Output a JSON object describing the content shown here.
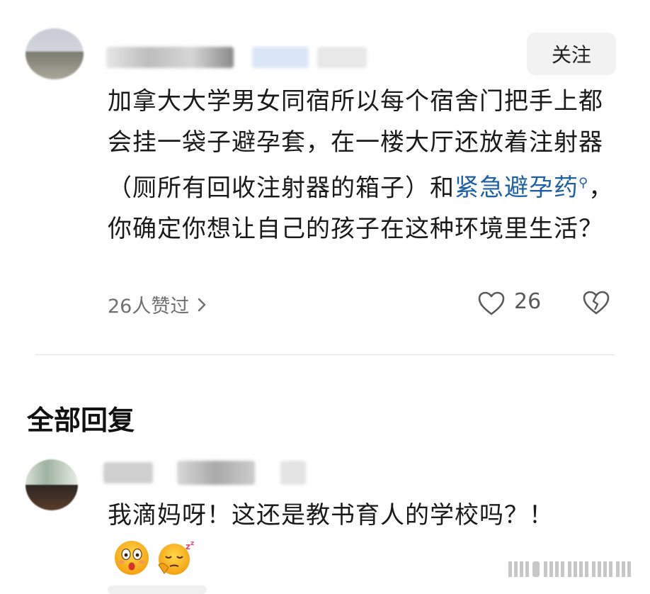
{
  "comment": {
    "follow_label": "关注",
    "text_before_link": "加拿大大学男女同宿所以每个宿舍门把手上都会挂一袋子避孕套，在一楼大厅还放着注射器（厕所有回收注射器的箱子）和",
    "link_text": "紧急避孕药",
    "text_after_link": "，你确定你想让自己的孩子在这种环境里生活？",
    "likes_summary": "26人赞过",
    "like_count": "26"
  },
  "replies_section": {
    "title": "全部回复"
  },
  "reply": {
    "text": "我滴妈呀！这还是教书育人的学校吗？！",
    "emojis": [
      "astonished-face-emoji",
      "sleepy-face-emoji"
    ]
  },
  "colors": {
    "link": "#1f5fa6",
    "secondary_text": "#707070",
    "follow_bg": "#f2f2f2"
  }
}
